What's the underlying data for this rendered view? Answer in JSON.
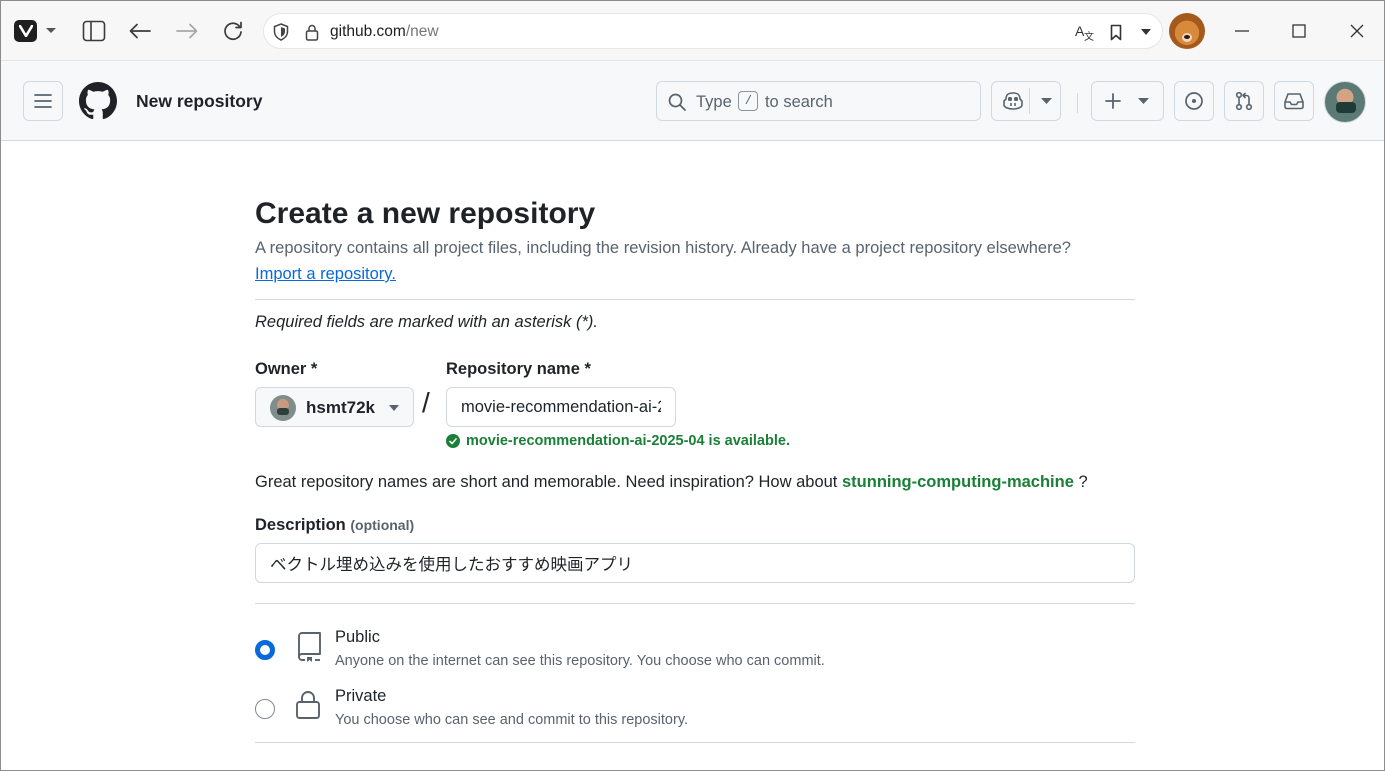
{
  "browser": {
    "url_host": "github.com",
    "url_path": "/new"
  },
  "header": {
    "title": "New repository",
    "search": {
      "prefix": "Type",
      "key": "/",
      "suffix": "to search"
    }
  },
  "page": {
    "title": "Create a new repository",
    "subtitle": "A repository contains all project files, including the revision history. Already have a project repository elsewhere?",
    "import_link": "Import a repository.",
    "required_note": "Required fields are marked with an asterisk (*).",
    "owner_label": "Owner *",
    "owner_value": "hsmt72k",
    "repo_name_label": "Repository name *",
    "repo_name_value": "movie-recommendation-ai-2025-04",
    "availability": "movie-recommendation-ai-2025-04 is available.",
    "inspiration_prefix": "Great repository names are short and memorable. Need inspiration? How about",
    "inspiration_suggestion": "stunning-computing-machine",
    "inspiration_suffix": "?",
    "description_label": "Description",
    "description_optional": "(optional)",
    "description_value": "ベクトル埋め込みを使用したおすすめ映画アプリ",
    "visibility": [
      {
        "title": "Public",
        "desc": "Anyone on the internet can see this repository. You choose who can commit.",
        "selected": true,
        "icon": "repo-icon"
      },
      {
        "title": "Private",
        "desc": "You choose who can see and commit to this repository.",
        "selected": false,
        "icon": "lock-icon"
      }
    ]
  },
  "colors": {
    "accent": "#0969da",
    "success": "#1a7f37",
    "border": "#d1d9e0"
  }
}
